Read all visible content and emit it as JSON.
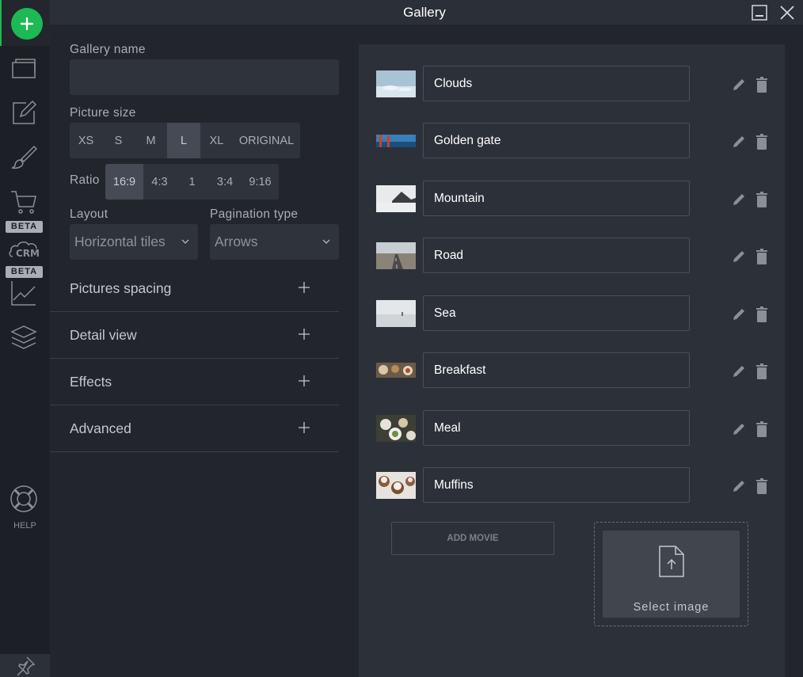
{
  "window": {
    "title": "Gallery"
  },
  "rail": {
    "beta_1": "BETA",
    "crm_text": "CRM",
    "beta_2": "BETA",
    "help": "HELP"
  },
  "settings": {
    "gallery_name_label": "Gallery name",
    "gallery_name_value": "",
    "picture_size_label": "Picture size",
    "picture_sizes": [
      "XS",
      "S",
      "M",
      "L",
      "XL",
      "ORIGINAL"
    ],
    "picture_size_selected": "L",
    "ratio_label": "Ratio",
    "ratios": [
      "16:9",
      "4:3",
      "1",
      "3:4",
      "9:16"
    ],
    "ratio_selected": "16:9",
    "layout_label": "Layout",
    "layout_value": "Horizontal tiles",
    "pagination_label": "Pagination type",
    "pagination_value": "Arrows",
    "sections": [
      "Pictures spacing",
      "Detail view",
      "Effects",
      "Advanced"
    ]
  },
  "images": [
    {
      "name": "Clouds",
      "thumb": "clouds"
    },
    {
      "name": "Golden gate",
      "thumb": "golden-gate"
    },
    {
      "name": "Mountain",
      "thumb": "mountain"
    },
    {
      "name": "Road",
      "thumb": "road"
    },
    {
      "name": "Sea",
      "thumb": "sea"
    },
    {
      "name": "Breakfast",
      "thumb": "breakfast"
    },
    {
      "name": "Meal",
      "thumb": "meal"
    },
    {
      "name": "Muffins",
      "thumb": "muffins"
    }
  ],
  "actions": {
    "add_movie": "ADD MOVIE",
    "select_image": "Select image"
  },
  "colors": {
    "accent": "#1db954",
    "background": "#22252c",
    "panel": "#2c3038"
  }
}
